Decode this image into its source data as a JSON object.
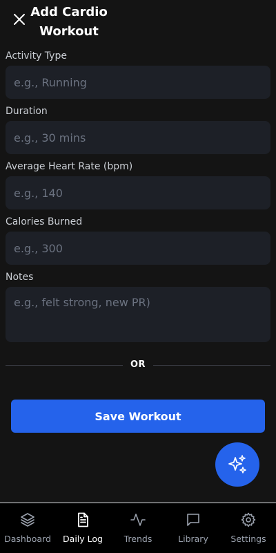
{
  "header": {
    "title_line1": "Add Cardio",
    "title_line2": "Workout",
    "close_icon": "close-icon"
  },
  "form": {
    "activity": {
      "label": "Activity Type",
      "placeholder": "e.g., Running",
      "value": ""
    },
    "duration": {
      "label": "Duration",
      "placeholder": "e.g., 30 mins",
      "value": ""
    },
    "heart_rate": {
      "label": "Average Heart Rate (bpm)",
      "placeholder": "e.g., 140",
      "value": ""
    },
    "calories": {
      "label": "Calories Burned",
      "placeholder": "e.g., 300",
      "value": ""
    },
    "notes": {
      "label": "Notes",
      "placeholder": "e.g., felt strong, new PR)",
      "value": ""
    }
  },
  "divider_text": "OR",
  "save_label": "Save Workout",
  "fab_icon": "sparkles-icon",
  "nav": {
    "items": [
      {
        "label": "Dashboard",
        "icon": "layers-icon",
        "active": false
      },
      {
        "label": "Daily Log",
        "icon": "document-icon",
        "active": true
      },
      {
        "label": "Trends",
        "icon": "activity-icon",
        "active": false
      },
      {
        "label": "Library",
        "icon": "chat-square-icon",
        "active": false
      },
      {
        "label": "Settings",
        "icon": "gear-icon",
        "active": false
      }
    ]
  },
  "colors": {
    "background": "#141414",
    "input_bg": "#1d2027",
    "accent": "#2563eb",
    "nav_bg": "#000000",
    "muted_text": "#9ca3af"
  }
}
